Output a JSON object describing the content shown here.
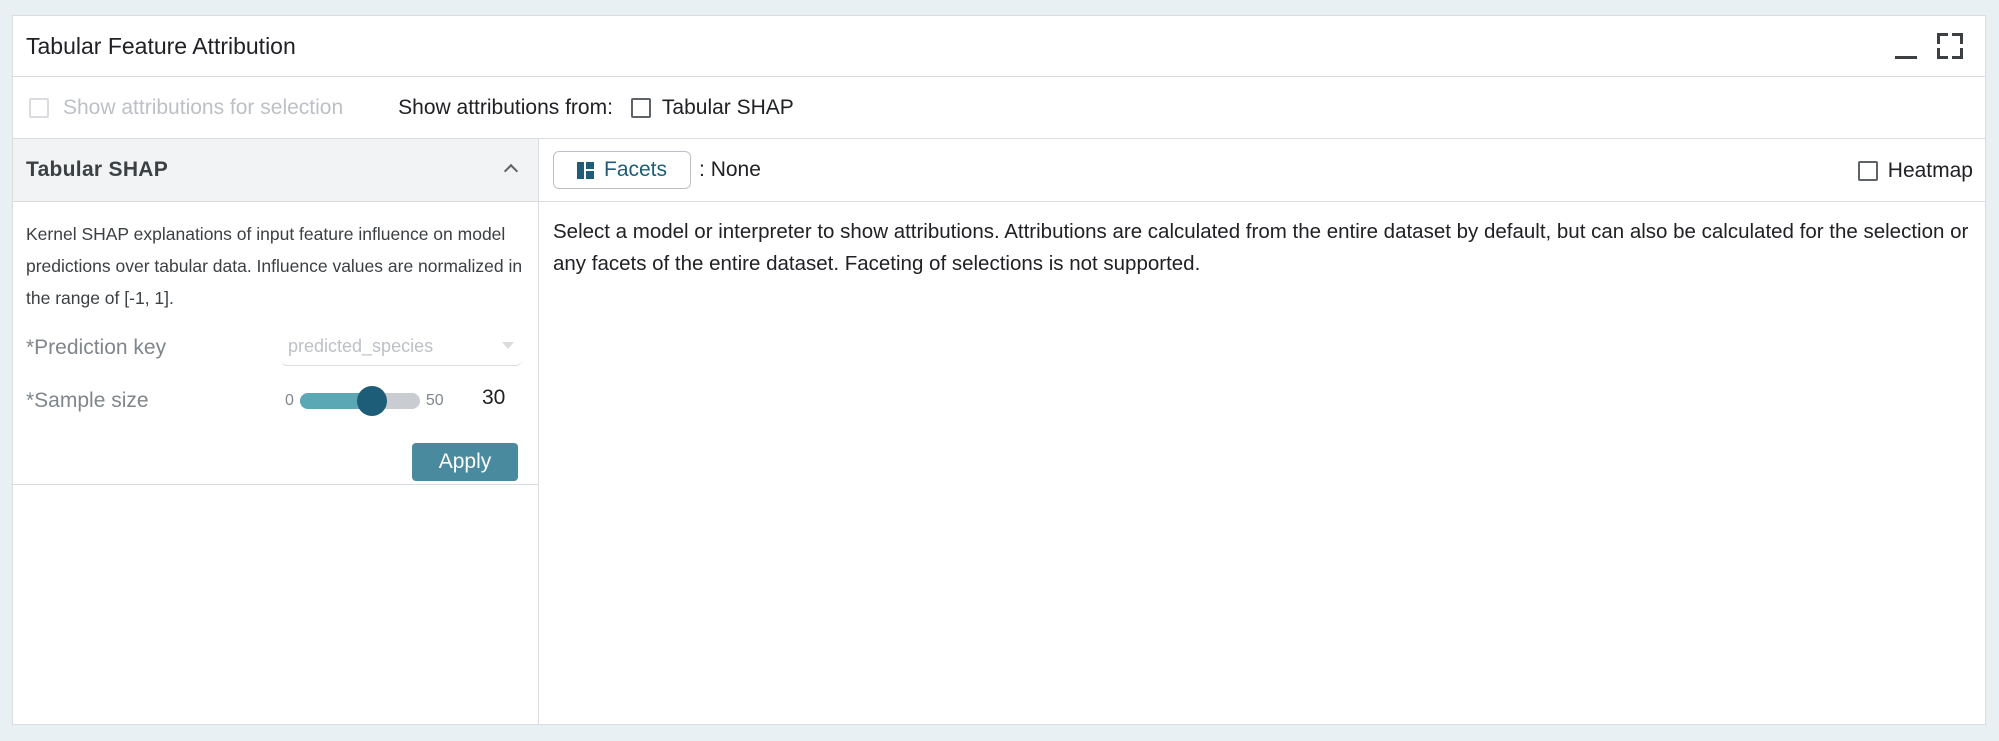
{
  "window": {
    "title": "Tabular Feature Attribution",
    "minimize_icon": "minimize-icon",
    "maximize_icon": "maximize-icon"
  },
  "toolbar": {
    "show_for_selection_label": "Show attributions for selection",
    "show_for_selection_checked": false,
    "show_for_selection_disabled": true,
    "show_from_label": "Show attributions from:",
    "sources": [
      {
        "label": "Tabular SHAP",
        "checked": false
      }
    ]
  },
  "interpreter": {
    "title": "Tabular SHAP",
    "expanded": true,
    "description": "Kernel SHAP explanations of input feature influence on model predictions over tabular data. Influence values are normalized in the range of [-1, 1].",
    "prediction_key": {
      "label": "*Prediction key",
      "value": "predicted_species"
    },
    "sample_size": {
      "label": "*Sample size",
      "min": "0",
      "max": "50",
      "value": "30",
      "fraction": 0.6
    },
    "apply_label": "Apply"
  },
  "results": {
    "facets_label": "Facets",
    "facets_value": ": None",
    "heatmap_label": "Heatmap",
    "heatmap_checked": false,
    "message": "Select a model or interpreter to show attributions. Attributions are calculated from the entire dataset by default, but can also be calculated for the selection or any facets of the entire dataset. Faceting of selections is not supported."
  },
  "colors": {
    "accent": "#1d5d77",
    "slider_fill": "#5aa7b5",
    "apply_button": "#4a8a9f",
    "background": "#e8f0f3"
  }
}
